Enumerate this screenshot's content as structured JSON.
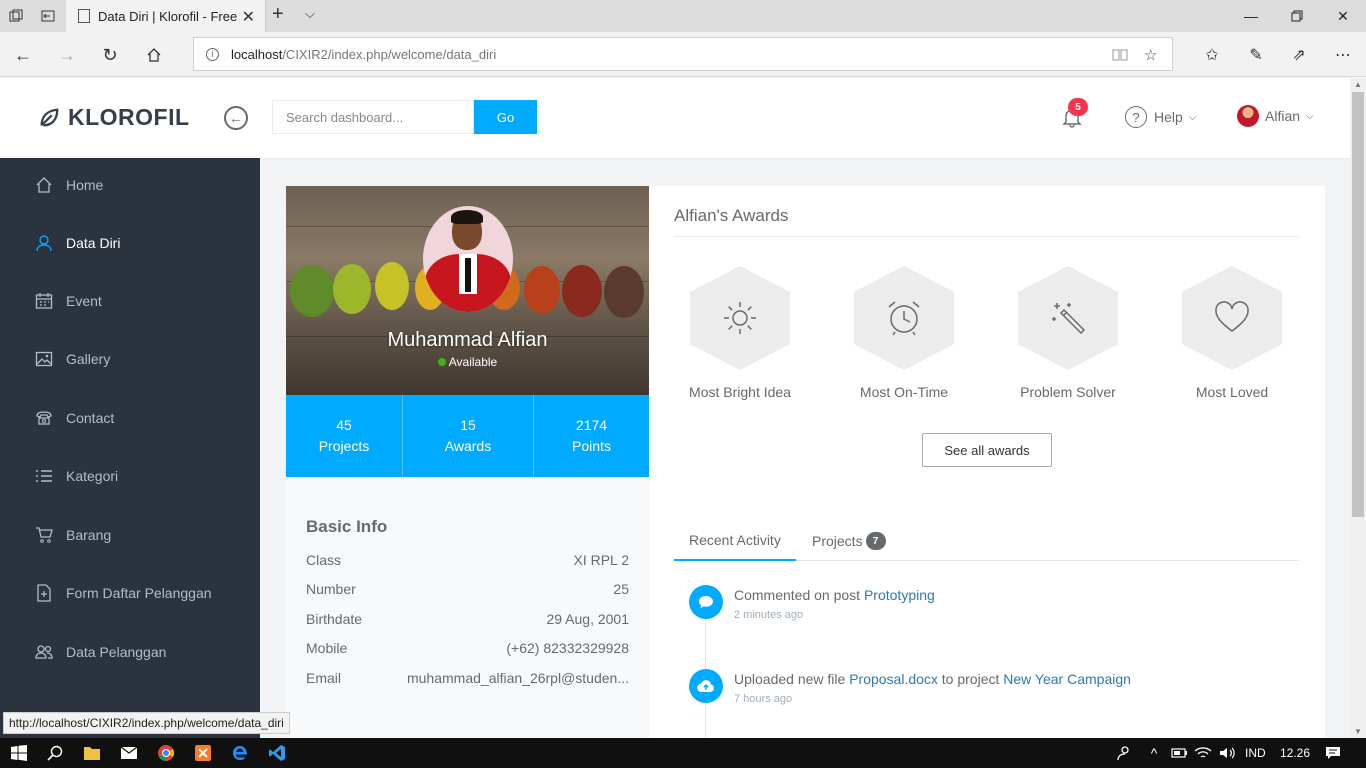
{
  "browser": {
    "tab_title": "Data Diri | Klorofil - Free",
    "url_host": "localhost",
    "url_path": "/CIXIR2/index.php/welcome/data_diri",
    "status_url": "http://localhost/CIXIR2/index.php/welcome/data_diri"
  },
  "topnav": {
    "brand": "KLOROFIL",
    "search_placeholder": "Search dashboard...",
    "go_label": "Go",
    "notif_count": "5",
    "help_label": "Help",
    "user_name": "Alfian"
  },
  "sidebar": {
    "items": [
      {
        "label": "Home",
        "icon": "home-icon"
      },
      {
        "label": "Data Diri",
        "icon": "user-icon",
        "active": true
      },
      {
        "label": "Event",
        "icon": "calendar-icon"
      },
      {
        "label": "Gallery",
        "icon": "image-icon"
      },
      {
        "label": "Contact",
        "icon": "phone-icon"
      },
      {
        "label": "Kategori",
        "icon": "list-icon"
      },
      {
        "label": "Barang",
        "icon": "cart-icon"
      },
      {
        "label": "Form Daftar Pelanggan",
        "icon": "file-add-icon"
      },
      {
        "label": "Data Pelanggan",
        "icon": "users-icon"
      }
    ]
  },
  "profile": {
    "name": "Muhammad Alfian",
    "status": "Available",
    "stats": [
      {
        "value": "45",
        "label": "Projects"
      },
      {
        "value": "15",
        "label": "Awards"
      },
      {
        "value": "2174",
        "label": "Points"
      }
    ],
    "basic_info_title": "Basic Info",
    "info": [
      {
        "label": "Class",
        "value": "XI RPL 2"
      },
      {
        "label": "Number",
        "value": "25"
      },
      {
        "label": "Birthdate",
        "value": "29 Aug, 2001"
      },
      {
        "label": "Mobile",
        "value": "(+62) 82332329928"
      },
      {
        "label": "Email",
        "value": "muhammad_alfian_26rpl@studen..."
      }
    ]
  },
  "awards": {
    "title": "Alfian's Awards",
    "items": [
      {
        "label": "Most Bright Idea",
        "icon": "sun-icon"
      },
      {
        "label": "Most On-Time",
        "icon": "alarm-clock-icon"
      },
      {
        "label": "Problem Solver",
        "icon": "magic-wand-icon"
      },
      {
        "label": "Most Loved",
        "icon": "heart-icon"
      }
    ],
    "see_all_label": "See all awards"
  },
  "tabs": {
    "recent_activity": "Recent Activity",
    "projects": "Projects",
    "projects_count": "7"
  },
  "activities": [
    {
      "prefix": "Commented on post ",
      "link1": "Prototyping",
      "middle": "",
      "link2": "",
      "time": "2 minutes ago",
      "icon": "comment-icon"
    },
    {
      "prefix": "Uploaded new file ",
      "link1": "Proposal.docx",
      "middle": " to project ",
      "link2": "New Year Campaign",
      "time": "7 hours ago",
      "icon": "cloud-upload-icon"
    }
  ],
  "taskbar": {
    "language": "IND",
    "clock": "12.26"
  },
  "colors": {
    "accent": "#00aaff",
    "sidebar_bg": "#2b333e",
    "badge_red": "#f9354c",
    "status_green": "#41b314"
  }
}
